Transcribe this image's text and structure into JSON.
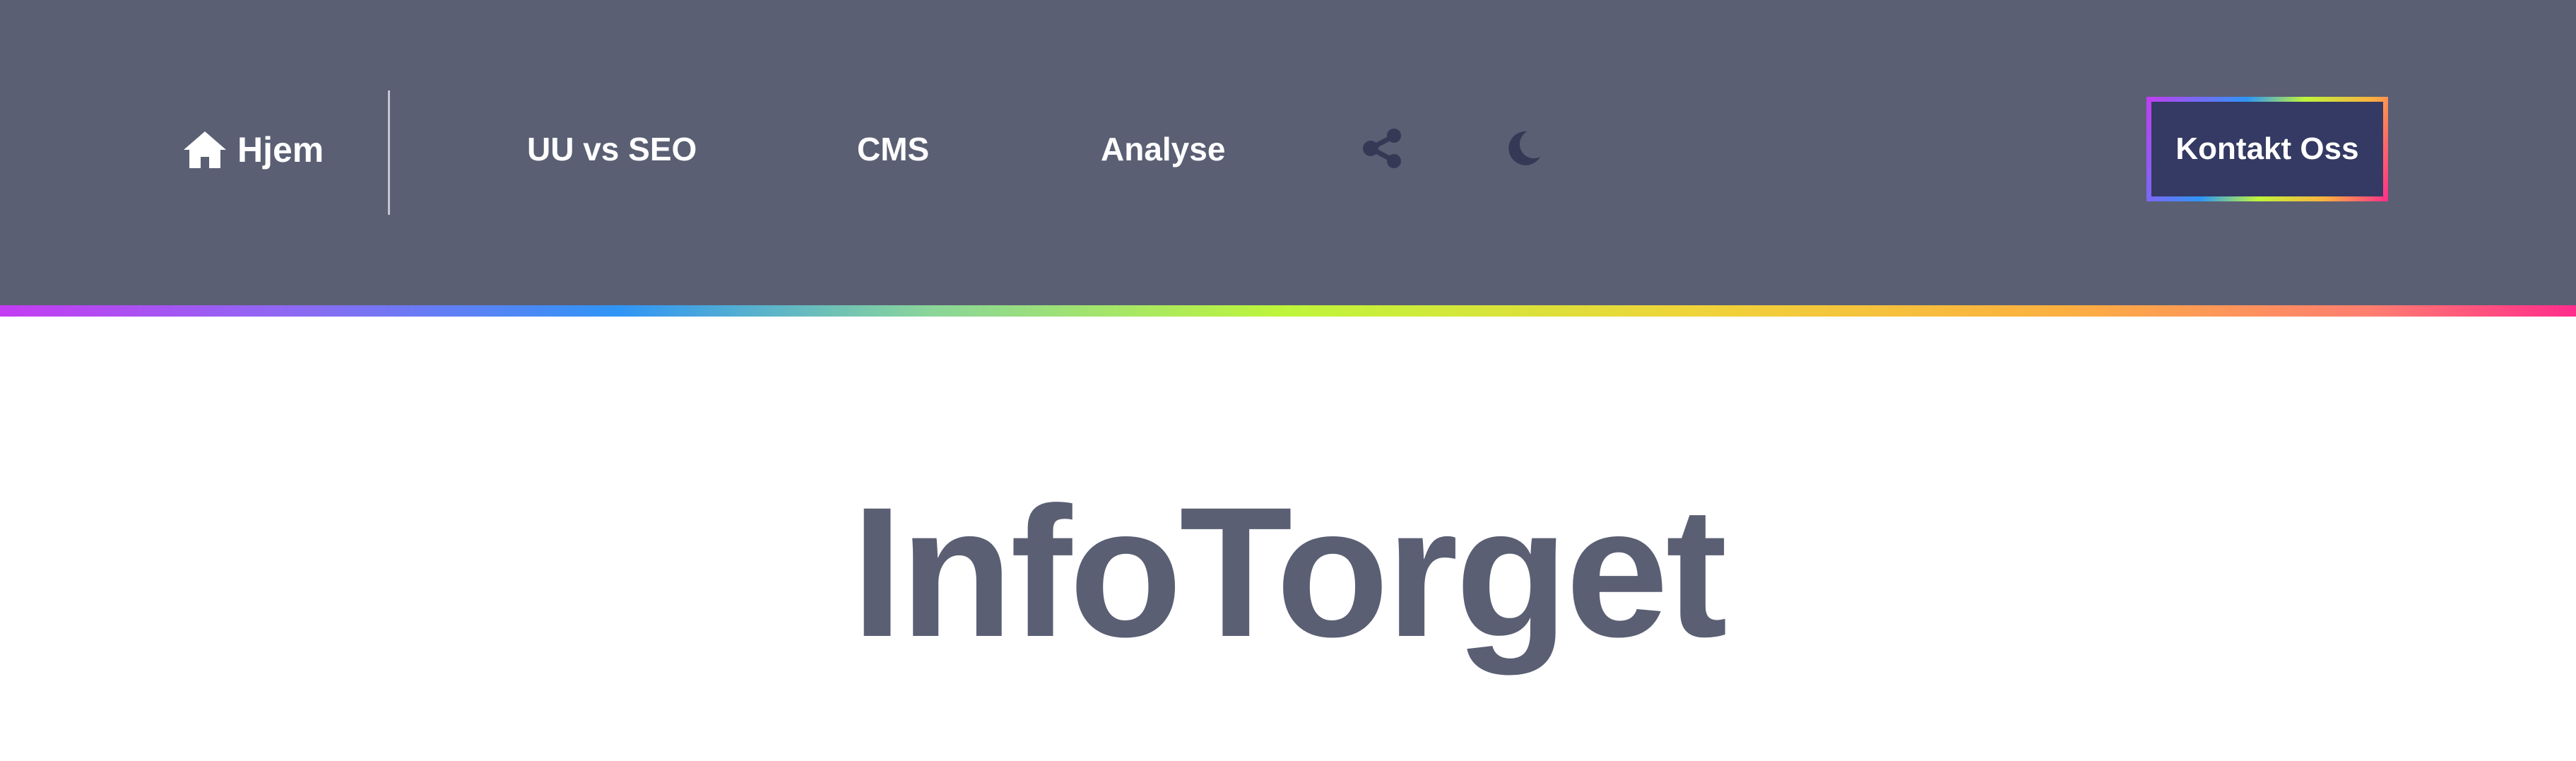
{
  "nav": {
    "home_label": "Hjem",
    "links": [
      "UU vs SEO",
      "CMS",
      "Analyse"
    ],
    "icons": {
      "home": "home-icon",
      "share": "share-icon",
      "theme_toggle": "moon-icon"
    },
    "contact_label": "Kontakt Oss"
  },
  "main": {
    "title": "InfoTorget"
  },
  "colors": {
    "navbar_bg": "#5a5f73",
    "contact_bg": "#343a63",
    "title_color": "#5a5f73",
    "icon_color": "#343a55",
    "gradient": [
      "#c43cf2",
      "#2f95f6",
      "#bff53a",
      "#fbb040",
      "#ff2c8c"
    ]
  }
}
